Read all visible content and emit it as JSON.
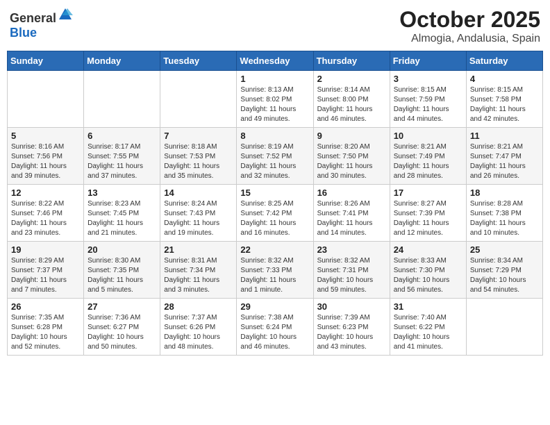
{
  "header": {
    "logo_general": "General",
    "logo_blue": "Blue",
    "month": "October 2025",
    "location": "Almogia, Andalusia, Spain"
  },
  "days_of_week": [
    "Sunday",
    "Monday",
    "Tuesday",
    "Wednesday",
    "Thursday",
    "Friday",
    "Saturday"
  ],
  "weeks": [
    [
      {
        "day": "",
        "sunrise": "",
        "sunset": "",
        "daylight": ""
      },
      {
        "day": "",
        "sunrise": "",
        "sunset": "",
        "daylight": ""
      },
      {
        "day": "",
        "sunrise": "",
        "sunset": "",
        "daylight": ""
      },
      {
        "day": "1",
        "sunrise": "Sunrise: 8:13 AM",
        "sunset": "Sunset: 8:02 PM",
        "daylight": "Daylight: 11 hours and 49 minutes."
      },
      {
        "day": "2",
        "sunrise": "Sunrise: 8:14 AM",
        "sunset": "Sunset: 8:00 PM",
        "daylight": "Daylight: 11 hours and 46 minutes."
      },
      {
        "day": "3",
        "sunrise": "Sunrise: 8:15 AM",
        "sunset": "Sunset: 7:59 PM",
        "daylight": "Daylight: 11 hours and 44 minutes."
      },
      {
        "day": "4",
        "sunrise": "Sunrise: 8:15 AM",
        "sunset": "Sunset: 7:58 PM",
        "daylight": "Daylight: 11 hours and 42 minutes."
      }
    ],
    [
      {
        "day": "5",
        "sunrise": "Sunrise: 8:16 AM",
        "sunset": "Sunset: 7:56 PM",
        "daylight": "Daylight: 11 hours and 39 minutes."
      },
      {
        "day": "6",
        "sunrise": "Sunrise: 8:17 AM",
        "sunset": "Sunset: 7:55 PM",
        "daylight": "Daylight: 11 hours and 37 minutes."
      },
      {
        "day": "7",
        "sunrise": "Sunrise: 8:18 AM",
        "sunset": "Sunset: 7:53 PM",
        "daylight": "Daylight: 11 hours and 35 minutes."
      },
      {
        "day": "8",
        "sunrise": "Sunrise: 8:19 AM",
        "sunset": "Sunset: 7:52 PM",
        "daylight": "Daylight: 11 hours and 32 minutes."
      },
      {
        "day": "9",
        "sunrise": "Sunrise: 8:20 AM",
        "sunset": "Sunset: 7:50 PM",
        "daylight": "Daylight: 11 hours and 30 minutes."
      },
      {
        "day": "10",
        "sunrise": "Sunrise: 8:21 AM",
        "sunset": "Sunset: 7:49 PM",
        "daylight": "Daylight: 11 hours and 28 minutes."
      },
      {
        "day": "11",
        "sunrise": "Sunrise: 8:21 AM",
        "sunset": "Sunset: 7:47 PM",
        "daylight": "Daylight: 11 hours and 26 minutes."
      }
    ],
    [
      {
        "day": "12",
        "sunrise": "Sunrise: 8:22 AM",
        "sunset": "Sunset: 7:46 PM",
        "daylight": "Daylight: 11 hours and 23 minutes."
      },
      {
        "day": "13",
        "sunrise": "Sunrise: 8:23 AM",
        "sunset": "Sunset: 7:45 PM",
        "daylight": "Daylight: 11 hours and 21 minutes."
      },
      {
        "day": "14",
        "sunrise": "Sunrise: 8:24 AM",
        "sunset": "Sunset: 7:43 PM",
        "daylight": "Daylight: 11 hours and 19 minutes."
      },
      {
        "day": "15",
        "sunrise": "Sunrise: 8:25 AM",
        "sunset": "Sunset: 7:42 PM",
        "daylight": "Daylight: 11 hours and 16 minutes."
      },
      {
        "day": "16",
        "sunrise": "Sunrise: 8:26 AM",
        "sunset": "Sunset: 7:41 PM",
        "daylight": "Daylight: 11 hours and 14 minutes."
      },
      {
        "day": "17",
        "sunrise": "Sunrise: 8:27 AM",
        "sunset": "Sunset: 7:39 PM",
        "daylight": "Daylight: 11 hours and 12 minutes."
      },
      {
        "day": "18",
        "sunrise": "Sunrise: 8:28 AM",
        "sunset": "Sunset: 7:38 PM",
        "daylight": "Daylight: 11 hours and 10 minutes."
      }
    ],
    [
      {
        "day": "19",
        "sunrise": "Sunrise: 8:29 AM",
        "sunset": "Sunset: 7:37 PM",
        "daylight": "Daylight: 11 hours and 7 minutes."
      },
      {
        "day": "20",
        "sunrise": "Sunrise: 8:30 AM",
        "sunset": "Sunset: 7:35 PM",
        "daylight": "Daylight: 11 hours and 5 minutes."
      },
      {
        "day": "21",
        "sunrise": "Sunrise: 8:31 AM",
        "sunset": "Sunset: 7:34 PM",
        "daylight": "Daylight: 11 hours and 3 minutes."
      },
      {
        "day": "22",
        "sunrise": "Sunrise: 8:32 AM",
        "sunset": "Sunset: 7:33 PM",
        "daylight": "Daylight: 11 hours and 1 minute."
      },
      {
        "day": "23",
        "sunrise": "Sunrise: 8:32 AM",
        "sunset": "Sunset: 7:31 PM",
        "daylight": "Daylight: 10 hours and 59 minutes."
      },
      {
        "day": "24",
        "sunrise": "Sunrise: 8:33 AM",
        "sunset": "Sunset: 7:30 PM",
        "daylight": "Daylight: 10 hours and 56 minutes."
      },
      {
        "day": "25",
        "sunrise": "Sunrise: 8:34 AM",
        "sunset": "Sunset: 7:29 PM",
        "daylight": "Daylight: 10 hours and 54 minutes."
      }
    ],
    [
      {
        "day": "26",
        "sunrise": "Sunrise: 7:35 AM",
        "sunset": "Sunset: 6:28 PM",
        "daylight": "Daylight: 10 hours and 52 minutes."
      },
      {
        "day": "27",
        "sunrise": "Sunrise: 7:36 AM",
        "sunset": "Sunset: 6:27 PM",
        "daylight": "Daylight: 10 hours and 50 minutes."
      },
      {
        "day": "28",
        "sunrise": "Sunrise: 7:37 AM",
        "sunset": "Sunset: 6:26 PM",
        "daylight": "Daylight: 10 hours and 48 minutes."
      },
      {
        "day": "29",
        "sunrise": "Sunrise: 7:38 AM",
        "sunset": "Sunset: 6:24 PM",
        "daylight": "Daylight: 10 hours and 46 minutes."
      },
      {
        "day": "30",
        "sunrise": "Sunrise: 7:39 AM",
        "sunset": "Sunset: 6:23 PM",
        "daylight": "Daylight: 10 hours and 43 minutes."
      },
      {
        "day": "31",
        "sunrise": "Sunrise: 7:40 AM",
        "sunset": "Sunset: 6:22 PM",
        "daylight": "Daylight: 10 hours and 41 minutes."
      },
      {
        "day": "",
        "sunrise": "",
        "sunset": "",
        "daylight": ""
      }
    ]
  ]
}
